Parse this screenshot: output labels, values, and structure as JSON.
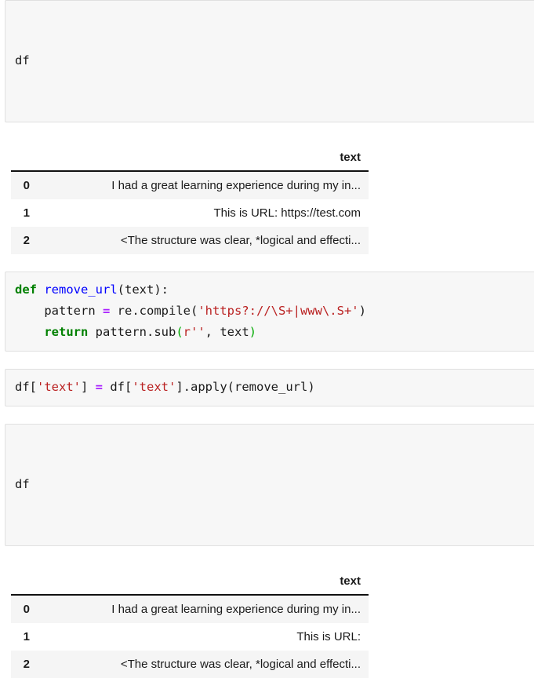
{
  "notebook": {
    "cells": [
      {
        "kind": "code",
        "name": "cell-df-1",
        "source": "df"
      },
      {
        "kind": "dataframe",
        "name": "dataframe-output-1",
        "index_header": "",
        "columns": [
          "text"
        ],
        "rows": [
          {
            "index": "0",
            "text": "I had a great learning experience during my in..."
          },
          {
            "index": "1",
            "text": "This is URL: https://test.com"
          },
          {
            "index": "2",
            "text": "<The structure was clear, *logical and effecti..."
          }
        ]
      },
      {
        "kind": "code",
        "name": "cell-remove-url",
        "lines": [
          {
            "tokens": [
              {
                "t": "def ",
                "c": "kw"
              },
              {
                "t": "remove_url",
                "c": "fn"
              },
              {
                "t": "(text):",
                "c": "plain"
              }
            ]
          },
          {
            "tokens": [
              {
                "t": "    pattern ",
                "c": "plain"
              },
              {
                "t": "=",
                "c": "op"
              },
              {
                "t": " re.compile(",
                "c": "plain"
              },
              {
                "t": "'https?://\\S+|www\\.S+'",
                "c": "str"
              },
              {
                "t": ")",
                "c": "plain"
              }
            ]
          },
          {
            "tokens": [
              {
                "t": "    ",
                "c": "plain"
              },
              {
                "t": "return",
                "c": "kw"
              },
              {
                "t": " pattern.sub",
                "c": "plain"
              },
              {
                "t": "(",
                "c": "grn"
              },
              {
                "t": "r''",
                "c": "str"
              },
              {
                "t": ", text",
                "c": "plain"
              },
              {
                "t": ")",
                "c": "grn"
              }
            ]
          }
        ]
      },
      {
        "kind": "code",
        "name": "cell-apply-remove-url",
        "lines": [
          {
            "tokens": [
              {
                "t": "df[",
                "c": "plain"
              },
              {
                "t": "'text'",
                "c": "str"
              },
              {
                "t": "] ",
                "c": "plain"
              },
              {
                "t": "=",
                "c": "op"
              },
              {
                "t": " df[",
                "c": "plain"
              },
              {
                "t": "'text'",
                "c": "str"
              },
              {
                "t": "].apply(remove_url)",
                "c": "plain"
              }
            ]
          }
        ]
      },
      {
        "kind": "code",
        "name": "cell-df-2",
        "source": "df"
      },
      {
        "kind": "dataframe",
        "name": "dataframe-output-2",
        "index_header": "",
        "columns": [
          "text"
        ],
        "rows": [
          {
            "index": "0",
            "text": "I had a great learning experience during my in..."
          },
          {
            "index": "1",
            "text": "This is URL:"
          },
          {
            "index": "2",
            "text": "<The structure was clear, *logical and effecti..."
          }
        ]
      }
    ]
  },
  "colors": {
    "cell_background": "#f7f7f7",
    "cell_border": "#e0e0e0",
    "keyword": "#008000",
    "function_name": "#0000ff",
    "string": "#ba2121",
    "operator": "#aa22ff",
    "row_stripe": "#f5f5f5",
    "header_rule": "#111111"
  }
}
